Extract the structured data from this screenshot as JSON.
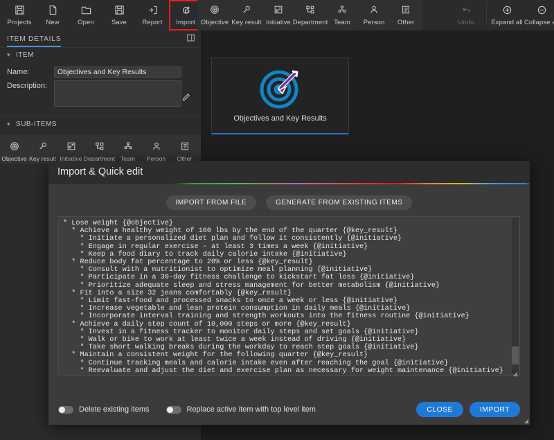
{
  "toolbar": {
    "left_items": [
      {
        "label": "Projects",
        "icon": "save-disk-icon",
        "highlight": false
      },
      {
        "label": "New",
        "icon": "new-file-icon",
        "highlight": false
      },
      {
        "label": "Open",
        "icon": "open-folder-icon",
        "highlight": false
      },
      {
        "label": "Save",
        "icon": "floppy-save-icon",
        "highlight": false
      },
      {
        "label": "Report",
        "icon": "report-export-icon",
        "highlight": false
      },
      {
        "label": "Import",
        "icon": "import-refresh-icon",
        "highlight": true
      }
    ],
    "item_types": [
      {
        "label": "Objective",
        "icon": "objective-target-icon"
      },
      {
        "label": "Key result",
        "icon": "key-result-key-icon"
      },
      {
        "label": "Initiative",
        "icon": "initiative-card-icon"
      },
      {
        "label": "Department",
        "icon": "department-org-icon"
      },
      {
        "label": "Team",
        "icon": "team-people-icon"
      },
      {
        "label": "Person",
        "icon": "person-icon"
      },
      {
        "label": "Other",
        "icon": "other-list-icon"
      }
    ],
    "right_items": [
      {
        "label": "Undo",
        "icon": "undo-arrow-icon",
        "disabled": true
      },
      {
        "label": "Expand all",
        "icon": "plus-circle-icon",
        "disabled": false
      },
      {
        "label": "Collapse all",
        "icon": "minus-circle-icon",
        "disabled": false
      }
    ]
  },
  "left_panel": {
    "title": "ITEM DETAILS",
    "pin_icon": "panel-layout-icon",
    "item_section": {
      "header": "ITEM",
      "name_label": "Name:",
      "name_value": "Objectives and Key Results",
      "name_placeholder": "",
      "description_label": "Description:",
      "description_value": "",
      "description_placeholder": "",
      "edit_icon": "pencil-edit-icon"
    },
    "subitems_section": {
      "header": "SUB-ITEMS",
      "items": [
        {
          "label": "Objective",
          "icon": "objective-target-icon"
        },
        {
          "label": "Key result",
          "icon": "key-result-key-icon"
        },
        {
          "label": "Initiative",
          "icon": "initiative-card-icon"
        },
        {
          "label": "Department",
          "icon": "department-org-icon"
        },
        {
          "label": "Team",
          "icon": "team-people-icon"
        },
        {
          "label": "Person",
          "icon": "person-icon"
        },
        {
          "label": "Other",
          "icon": "other-list-icon"
        }
      ]
    }
  },
  "canvas": {
    "node": {
      "label": "Objectives and Key Results",
      "icon": "target-dartboard-icon",
      "ring_color": "#1184c4",
      "arrow_color": "#7b2d8e",
      "underline_color": "#2e6fc4"
    }
  },
  "modal": {
    "title": "Import & Quick edit",
    "accent_line": "rainbow-gradient",
    "buttons": {
      "import_from_file": "IMPORT FROM FILE",
      "generate_from_existing": "GENERATE FROM EXISTING ITEMS"
    },
    "textarea": {
      "placeholder": "",
      "content": "* Lose weight {@objective}\n  * Achieve a healthy weight of 160 lbs by the end of the quarter {@key_result}\n    * Initiate a personalized diet plan and follow it consistently {@initiative}\n    * Engage in regular exercise - at least 3 times a week {@initiative}\n    * Keep a food diary to track daily calorie intake {@initiative}\n  * Reduce body fat percentage to 20% or less {@key_result}\n    * Consult with a nutritionist to optimize meal planning {@initiative}\n    * Participate in a 30-day fitness challenge to kickstart fat loss {@initiative}\n    * Prioritize adequate sleep and stress management for better metabolism {@initiative}\n  * Fit into a size 32 jeans comfortably {@key_result}\n    * Limit fast-food and processed snacks to once a week or less {@initiative}\n    * Increase vegetable and lean protein consumption in daily meals {@initiative}\n    * Incorporate interval training and strength workouts into the fitness routine {@initiative}\n  * Achieve a daily step count of 10,000 steps or more {@key_result}\n    * Invest in a fitness tracker to monitor daily steps and set goals {@initiative}\n    * Walk or bike to work at least twice a week instead of driving {@initiative}\n    * Take short walking breaks during the workday to reach step goals {@initiative}\n  * Maintain a consistent weight for the following quarter {@key_result}\n    * Continue tracking meals and calorie intake even after reaching the goal {@initiative}\n    * Reevaluate and adjust the diet and exercise plan as necessary for weight maintenance {@initiative}"
    },
    "toggles": [
      {
        "label": "Delete existing items",
        "on": false
      },
      {
        "label": "Replace active item with top level item",
        "on": false
      }
    ],
    "footer_buttons": {
      "close": "CLOSE",
      "import": "IMPORT"
    },
    "accent_color": "#1e7ad6"
  }
}
